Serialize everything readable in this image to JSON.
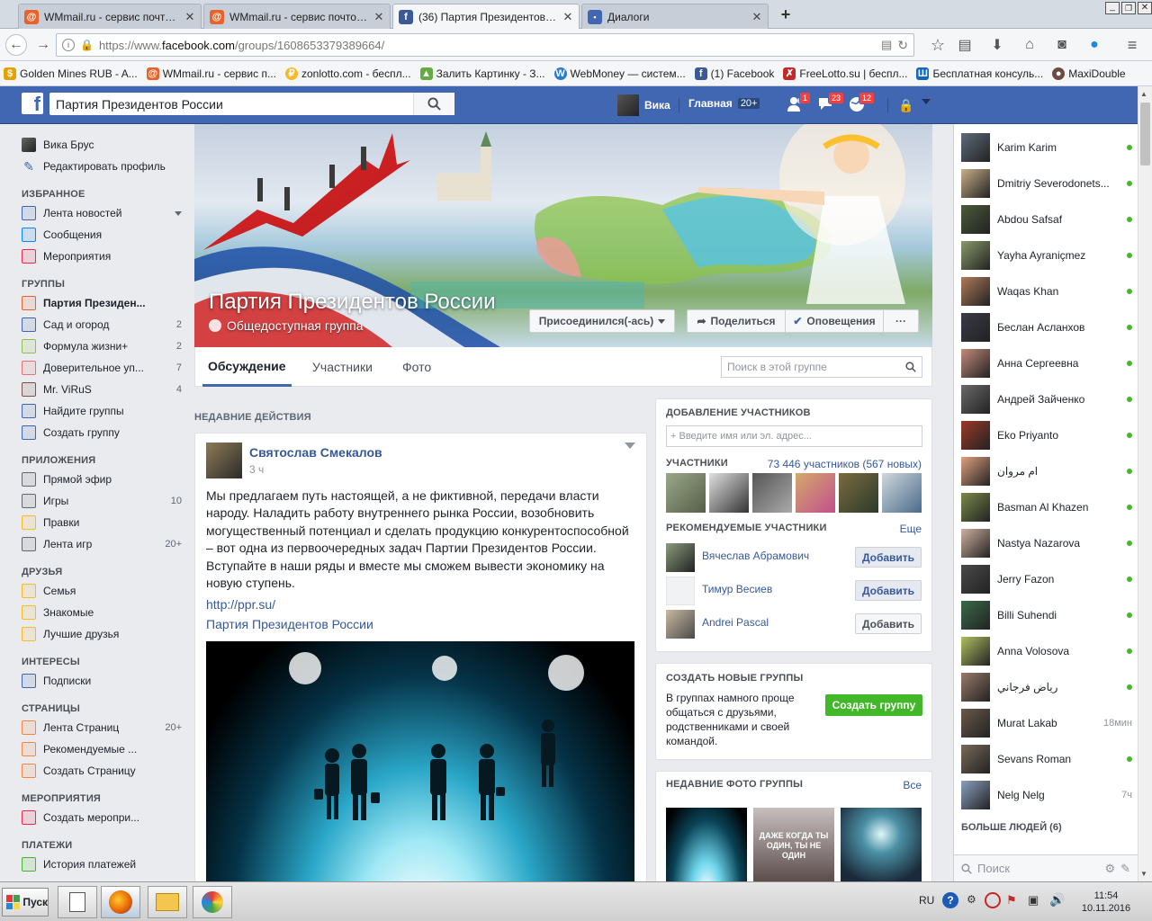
{
  "browser": {
    "tabs": [
      {
        "title": "WMmail.ru - сервис почтовы...",
        "active": false
      },
      {
        "title": "WMmail.ru - сервис почтовы...",
        "active": false
      },
      {
        "title": "(36) Партия Президентов Р...",
        "active": true
      },
      {
        "title": "Диалоги",
        "active": false
      }
    ],
    "new_tab": "+",
    "url_prefix": "https://www.",
    "url_domain": "facebook.com",
    "url_path": "/groups/1608653379389664/",
    "bookmarks": [
      "Golden Mines RUB - A...",
      "WMmail.ru - сервис п...",
      "zonlotto.com - беспл...",
      "Залить Картинку - З...",
      "WebMoney — систем...",
      "(1) Facebook",
      "FreeLotto.su | беспл...",
      "Бесплатная консуль...",
      "MaxiDouble"
    ]
  },
  "fb_header": {
    "logo": "f",
    "search_value": "Партия Президентов России",
    "user_name": "Вика",
    "home_label": "Главная",
    "home_count": "20+",
    "friends_badge": "1",
    "messages_badge": "23",
    "notif_badge": "12"
  },
  "left_nav": {
    "user_name": "Вика Брус",
    "edit_profile": "Редактировать профиль",
    "sections": [
      {
        "head": "ИЗБРАННОЕ",
        "items": [
          {
            "label": "Лента новостей",
            "count": "",
            "icon": "news-feed-icon",
            "color": "#4267b2"
          },
          {
            "label": "Сообщения",
            "count": "",
            "icon": "messages-icon",
            "color": "#0084ff"
          },
          {
            "label": "Мероприятия",
            "count": "",
            "icon": "calendar-icon",
            "color": "#f02849"
          }
        ]
      },
      {
        "head": "ГРУППЫ",
        "items": [
          {
            "label": "Партия Президен...",
            "count": "",
            "icon": "group-icon",
            "color": "#e8632c",
            "bold": true
          },
          {
            "label": "Сад и огород",
            "count": "2",
            "icon": "group-icon",
            "color": "#4267b2"
          },
          {
            "label": "Формула жизни+",
            "count": "2",
            "icon": "group-icon",
            "color": "#8bc34a"
          },
          {
            "label": "Доверительное уп...",
            "count": "7",
            "icon": "group-icon",
            "color": "#e57373"
          },
          {
            "label": "Mr. ViRuS",
            "count": "4",
            "icon": "group-icon",
            "color": "#795548"
          },
          {
            "label": "Найдите группы",
            "count": "",
            "icon": "compass-icon",
            "color": "#4267b2"
          },
          {
            "label": "Создать группу",
            "count": "",
            "icon": "plus-icon",
            "color": "#4267b2"
          }
        ]
      },
      {
        "head": "ПРИЛОЖЕНИЯ",
        "items": [
          {
            "label": "Прямой эфир",
            "count": "",
            "icon": "live-icon",
            "color": "#616770"
          },
          {
            "label": "Игры",
            "count": "10",
            "icon": "games-icon",
            "color": "#616770"
          },
          {
            "label": "Правки",
            "count": "",
            "icon": "pencil-icon",
            "color": "#f7b928"
          },
          {
            "label": "Лента игр",
            "count": "20+",
            "icon": "gamepad-icon",
            "color": "#616770"
          }
        ]
      },
      {
        "head": "ДРУЗЬЯ",
        "items": [
          {
            "label": "Семья",
            "count": "",
            "icon": "star-icon",
            "color": "#f7b928"
          },
          {
            "label": "Знакомые",
            "count": "",
            "icon": "friend-list-icon",
            "color": "#f7b928"
          },
          {
            "label": "Лучшие друзья",
            "count": "",
            "icon": "star-icon",
            "color": "#f7b928"
          }
        ]
      },
      {
        "head": "ИНТЕРЕСЫ",
        "items": [
          {
            "label": "Подписки",
            "count": "",
            "icon": "rss-icon",
            "color": "#4267b2"
          }
        ]
      },
      {
        "head": "СТРАНИЦЫ",
        "items": [
          {
            "label": "Лента Страниц",
            "count": "20+",
            "icon": "flag-icon",
            "color": "#f5853f"
          },
          {
            "label": "Рекомендуемые ...",
            "count": "",
            "icon": "flag-icon",
            "color": "#f5853f"
          },
          {
            "label": "Создать Страницу",
            "count": "",
            "icon": "plus-icon",
            "color": "#f5853f"
          }
        ]
      },
      {
        "head": "МЕРОПРИЯТИЯ",
        "items": [
          {
            "label": "Создать меропри...",
            "count": "",
            "icon": "plus-icon",
            "color": "#f02849"
          }
        ]
      },
      {
        "head": "ПЛАТЕЖИ",
        "items": [
          {
            "label": "История платежей",
            "count": "",
            "icon": "history-icon",
            "color": "#42b72a"
          }
        ]
      }
    ]
  },
  "group": {
    "name": "Партия Президентов России",
    "type": "Общедоступная группа",
    "joined_btn": "Присоединился(-ась)",
    "share_btn": "Поделиться",
    "notif_btn": "Оповещения",
    "more_btn": "···",
    "tabs": [
      "Обсуждение",
      "Участники",
      "Фото"
    ],
    "search_placeholder": "Поиск в этой группе"
  },
  "feed": {
    "recent_header": "НЕДАВНИЕ ДЕЙСТВИЯ",
    "post": {
      "author": "Святослав Смекалов",
      "time": "3 ч",
      "text": "Мы предлагаем путь настоящей, а не фиктивной, передачи власти народу. Наладить работу внутреннего рынка России, возобновить могущественный потенциал и сделать продукцию конкурентоспособной – вот одна из первоочередных задач Партии Президентов России. Вступайте в наши ряды и вместе мы сможем вывести экономику на новую ступень.",
      "link": "http://ppr.su/",
      "link_title": "Партия Президентов России"
    }
  },
  "right": {
    "add_members_header": "ДОБАВЛЕНИЕ УЧАСТНИКОВ",
    "add_placeholder": "+ Введите имя или эл. адрес...",
    "members_label": "УЧАСТНИКИ",
    "members_count": "73 446 участников (567 новых)",
    "recommended_header": "РЕКОМЕНДУЕМЫЕ УЧАСТНИКИ",
    "recommended_more": "Еще",
    "recommended": [
      {
        "name": "Вячеслав Абрамович",
        "btn": "Добавить"
      },
      {
        "name": "Тимур Весиев",
        "btn": "Добавить"
      },
      {
        "name": "Andrei Pascal",
        "btn": "Добавить"
      }
    ],
    "create_header": "СОЗДАТЬ НОВЫЕ ГРУППЫ",
    "create_text": "В группах намного проще общаться с друзьями, родственниками и своей командой.",
    "create_btn": "Создать группу",
    "photos_header": "НЕДАВНИЕ ФОТО ГРУППЫ",
    "photos_all": "Все",
    "photo2_text": "ДАЖЕ КОГДА ТЫ ОДИН, ТЫ НЕ ОДИН"
  },
  "chat": {
    "contacts": [
      {
        "name": "Karim Karim",
        "status": ""
      },
      {
        "name": "Dmitriy Severodonets...",
        "status": ""
      },
      {
        "name": "Abdou Safsaf",
        "status": ""
      },
      {
        "name": "Yayha Ayraniçmez",
        "status": ""
      },
      {
        "name": "Waqas Khan",
        "status": ""
      },
      {
        "name": "Беслан Асланхов",
        "status": ""
      },
      {
        "name": "Анна Сергеевна",
        "status": ""
      },
      {
        "name": "Андрей Зайченко",
        "status": ""
      },
      {
        "name": "Eko Priyanto",
        "status": ""
      },
      {
        "name": "ام مروان",
        "status": ""
      },
      {
        "name": "Basman Al Khazen",
        "status": ""
      },
      {
        "name": "Nastya Nazarova",
        "status": ""
      },
      {
        "name": "Jerry Fazon",
        "status": ""
      },
      {
        "name": "Billi Suhendi",
        "status": ""
      },
      {
        "name": "Anna Volosova",
        "status": ""
      },
      {
        "name": "رياض فرجاني",
        "status": ""
      },
      {
        "name": "Murat Lakab",
        "status": "18мин"
      },
      {
        "name": "Sevans Roman",
        "status": ""
      },
      {
        "name": "Nelg Nelg",
        "status": "7ч"
      }
    ],
    "more_people": "БОЛЬШЕ ЛЮДЕЙ (6)",
    "search_placeholder": "Поиск"
  },
  "taskbar": {
    "start": "Пуск",
    "lang": "RU",
    "time": "11:54",
    "date": "10.11.2016"
  }
}
